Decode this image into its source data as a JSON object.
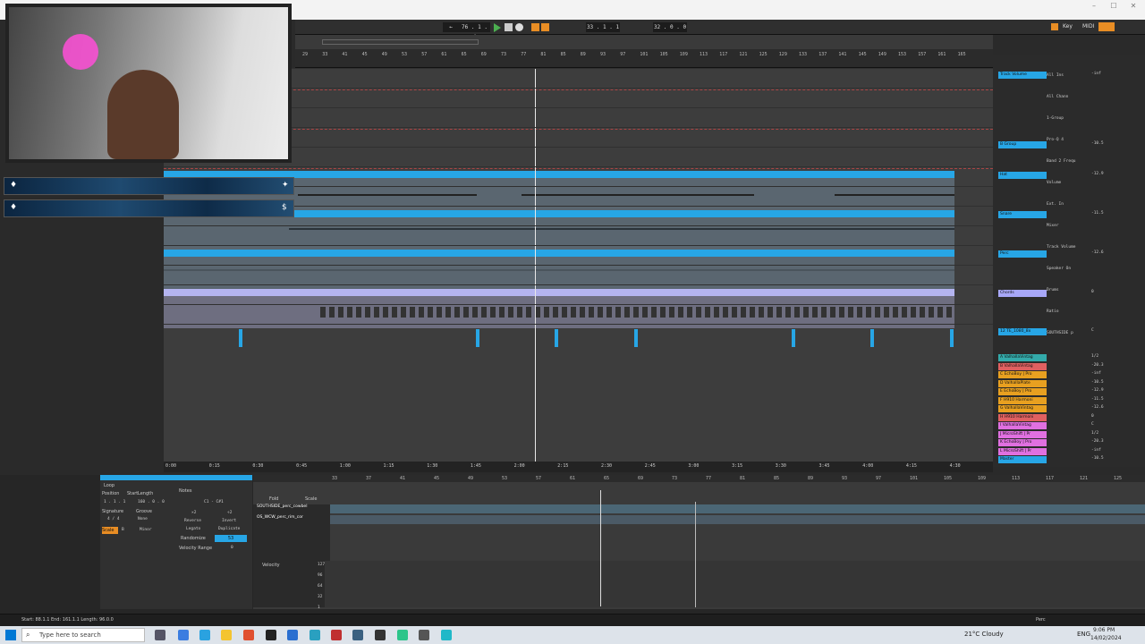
{
  "window": {
    "minimize": "–",
    "maximize": "☐",
    "close": "✕"
  },
  "transport": {
    "tempo": "76 . 1 . 4",
    "position": "33 . 1 . 1",
    "loop_end": "32 . 0 . 0",
    "key_label": "Key",
    "midi_label": "MIDI"
  },
  "ruler": [
    "29",
    "33",
    "41",
    "45",
    "49",
    "53",
    "57",
    "61",
    "65",
    "69",
    "73",
    "77",
    "81",
    "85",
    "89",
    "93",
    "97",
    "101",
    "105",
    "109",
    "113",
    "117",
    "121",
    "125",
    "129",
    "133",
    "137",
    "141",
    "145",
    "149",
    "153",
    "157",
    "161",
    "165"
  ],
  "timeline": [
    "0:00",
    "0:15",
    "0:30",
    "0:45",
    "1:00",
    "1:15",
    "1:30",
    "1:45",
    "2:00",
    "2:15",
    "2:30",
    "2:45",
    "3:00",
    "3:15",
    "3:30",
    "3:45",
    "4:00",
    "4:15",
    "4:30"
  ],
  "mixer": {
    "tracks": [
      {
        "name": "Track Volume",
        "color": "#27a6e6"
      },
      {
        "name": "B Group",
        "color": "#27a6e6"
      },
      {
        "name": "Hat",
        "color": "#27a6e6"
      },
      {
        "name": "Snare",
        "color": "#27a6e6"
      },
      {
        "name": "Perc",
        "color": "#27a6e6"
      },
      {
        "name": "Chords",
        "color": "#a8a8f8"
      },
      {
        "name": "12 TE_1080_8x",
        "color": "#27a6e6"
      },
      {
        "name": "A ValhallaVintag",
        "color": "#3aa"
      },
      {
        "name": "B ValhallaVintag",
        "color": "#e06060"
      },
      {
        "name": "C EchoBoy | Pro",
        "color": "#e8a020"
      },
      {
        "name": "D ValhallaPlate",
        "color": "#e8a020"
      },
      {
        "name": "E EchoBoy | Pro",
        "color": "#e8a020"
      },
      {
        "name": "F H910 Harmoni",
        "color": "#e8a020"
      },
      {
        "name": "G ValhallaVintag",
        "color": "#e8a020"
      },
      {
        "name": "H H910 Harmoni",
        "color": "#e06060"
      },
      {
        "name": "I ValhallaVintag",
        "color": "#e070e0"
      },
      {
        "name": "J MicroShift | Pr",
        "color": "#e070e0"
      },
      {
        "name": "K EchoBoy | Pro",
        "color": "#e070e0"
      },
      {
        "name": "L MicroShift | Pr",
        "color": "#e070e0"
      },
      {
        "name": "Master",
        "color": "#27a6e6"
      }
    ],
    "labels": [
      "All Ins",
      "All Chann",
      "1-Group",
      "Pro-Q 4",
      "Band 2 Frequ",
      "Volume",
      "Ext. In",
      "Mixer",
      "Track Volume",
      "Speaker On",
      "Drums",
      "Ratio",
      "SOUTHSIDE p"
    ],
    "values": [
      "-inf",
      "-10.5",
      "-12.9",
      "-11.5",
      "-12.6",
      "0",
      "C",
      "1/2",
      "-20.3"
    ]
  },
  "clip": {
    "notes_label": "Notes",
    "range": "C1 - C#1",
    "buttons": [
      "×2",
      "÷2",
      "Reverse",
      "Invert",
      "Legato",
      "Duplicate"
    ],
    "randomize_label": "Randomize",
    "randomize_value": "53",
    "velocity_range_label": "Velocity Range",
    "velocity_range_value": "0",
    "loop_label": "Loop",
    "position_label": "Position",
    "start_label": "Start",
    "length_label": "Length",
    "position_value": "1 . 1 . 1",
    "length_value": "160 . 0 . 0",
    "signature_label": "Signature",
    "signature": "4 / 4",
    "groove_label": "Groove",
    "groove_value": "None",
    "scale_label": "Scale",
    "scale_value": "B",
    "mode_value": "Minor",
    "fold_label": "Fold",
    "scale_header": "Scale"
  },
  "noteeditor": {
    "ruler": [
      "33",
      "37",
      "41",
      "45",
      "49",
      "53",
      "57",
      "61",
      "65",
      "69",
      "73",
      "77",
      "81",
      "85",
      "89",
      "93",
      "97",
      "101",
      "105",
      "109",
      "113",
      "117",
      "121",
      "125"
    ],
    "tracks": [
      "SOUTHSIDE_perc_cowbel",
      "OS_WCW_perc_rim_cor"
    ],
    "velocity_label": "Velocity",
    "velocity_ticks": [
      "127",
      "96",
      "64",
      "32",
      "1"
    ]
  },
  "status": {
    "selection": "Start: 88.1.1  End: 161.1.1  Length: 96.0.0",
    "track_label": "Perc"
  },
  "taskbar": {
    "search_placeholder": "Type here to search",
    "weather": "21°C  Cloudy",
    "lang": "ENG",
    "time": "9:06 PM",
    "date": "14/02/2024"
  }
}
